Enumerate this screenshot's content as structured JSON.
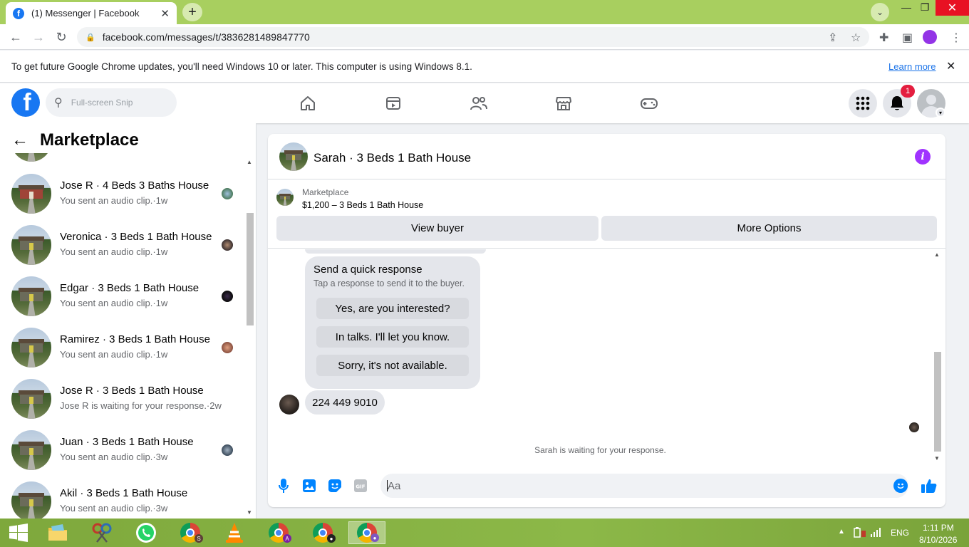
{
  "browser": {
    "tab_title": "(1) Messenger | Facebook",
    "tab_favicon": "facebook-icon",
    "url": "facebook.com/messages/t/3836281489847770",
    "accent": "#a8cf5f"
  },
  "infobar": {
    "message": "To get future Google Chrome updates, you'll need Windows 10 or later. This computer is using Windows 8.1.",
    "learn_more": "Learn more"
  },
  "fbnav": {
    "logo": "f",
    "search_placeholder": "Full-screen Snip",
    "notification_count": "1",
    "icons": [
      "home-icon",
      "watch-icon",
      "friends-icon",
      "marketplace-icon",
      "gaming-icon",
      "menu-grid-icon",
      "bell-icon",
      "profile-avatar"
    ]
  },
  "left_panel": {
    "title": "Marketplace",
    "conversations": [
      {
        "name": "Jose R · 4 Beds 3 Baths House",
        "sub": "You sent an audio clip.·1w"
      },
      {
        "name": "Veronica · 3 Beds 1 Bath House",
        "sub": "You sent an audio clip.·1w"
      },
      {
        "name": "Edgar · 3 Beds 1 Bath House",
        "sub": "You sent an audio clip.·1w"
      },
      {
        "name": "Ramirez · 3 Beds 1 Bath House",
        "sub": "You sent an audio clip.·1w"
      },
      {
        "name": "Jose R · 3 Beds 1 Bath House",
        "sub": "Jose R is waiting for your response.·2w"
      },
      {
        "name": "Juan · 3 Beds 1 Bath House",
        "sub": "You sent an audio clip.·3w"
      },
      {
        "name": "Akil · 3 Beds 1 Bath House",
        "sub": "You sent an audio clip.·3w"
      }
    ]
  },
  "chat": {
    "title": "Sarah · 3 Beds 1 Bath House",
    "listing_category": "Marketplace",
    "listing_price": "$1,200 – 3 Beds 1 Bath House",
    "view_buyer": "View buyer",
    "more_options": "More Options",
    "quick_response_title": "Send a quick response",
    "quick_response_sub": "Tap a response to send it to the buyer.",
    "quick_responses": [
      "Yes, are you interested?",
      "In talks. I'll let you know.",
      "Sorry, it's not available."
    ],
    "phone_message": "224 449 9010",
    "waiting": "Sarah is waiting for your response.",
    "composer_placeholder": "Aa"
  },
  "taskbar": {
    "language": "ENG",
    "time": "1:11 PM",
    "date": "8/10/2026"
  }
}
